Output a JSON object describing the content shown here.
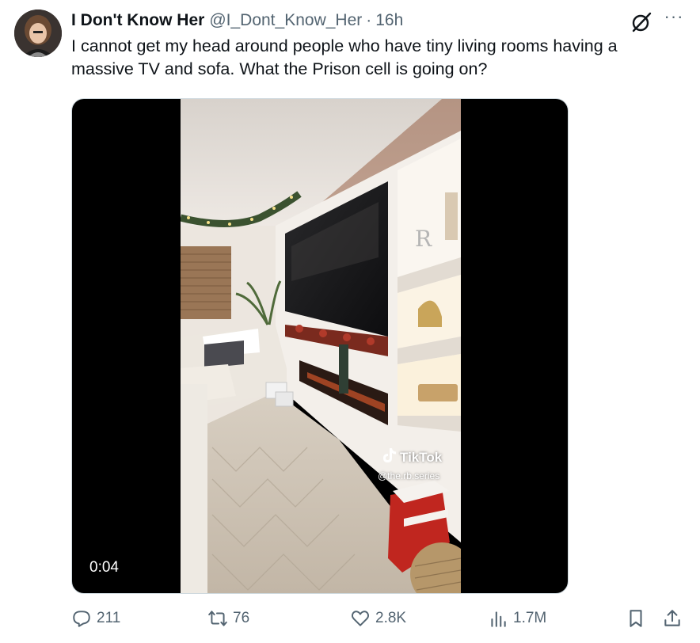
{
  "tweet": {
    "author_name": "I Don't Know Her",
    "handle": "@I_Dont_Know_Her",
    "separator": "·",
    "time": "16h",
    "more_label": "···",
    "text": "I cannot get my head around people who have tiny living rooms having a massive TV and sofa. What the Prison cell is going on?"
  },
  "media": {
    "timestamp": "0:04",
    "watermark_title": "TikTok",
    "watermark_user": "@the.rb.series",
    "shelf_letter": "R"
  },
  "actions": {
    "replies": "211",
    "reposts": "76",
    "likes": "2.8K",
    "views": "1.7M"
  },
  "icons": {
    "reply": "reply-icon",
    "repost": "repost-icon",
    "like": "like-icon",
    "views": "views-icon",
    "bookmark": "bookmark-icon",
    "share": "share-icon",
    "grok": "grok-icon"
  },
  "colors": {
    "text": "#0f1419",
    "secondary": "#536471",
    "media_bg": "#000000"
  }
}
